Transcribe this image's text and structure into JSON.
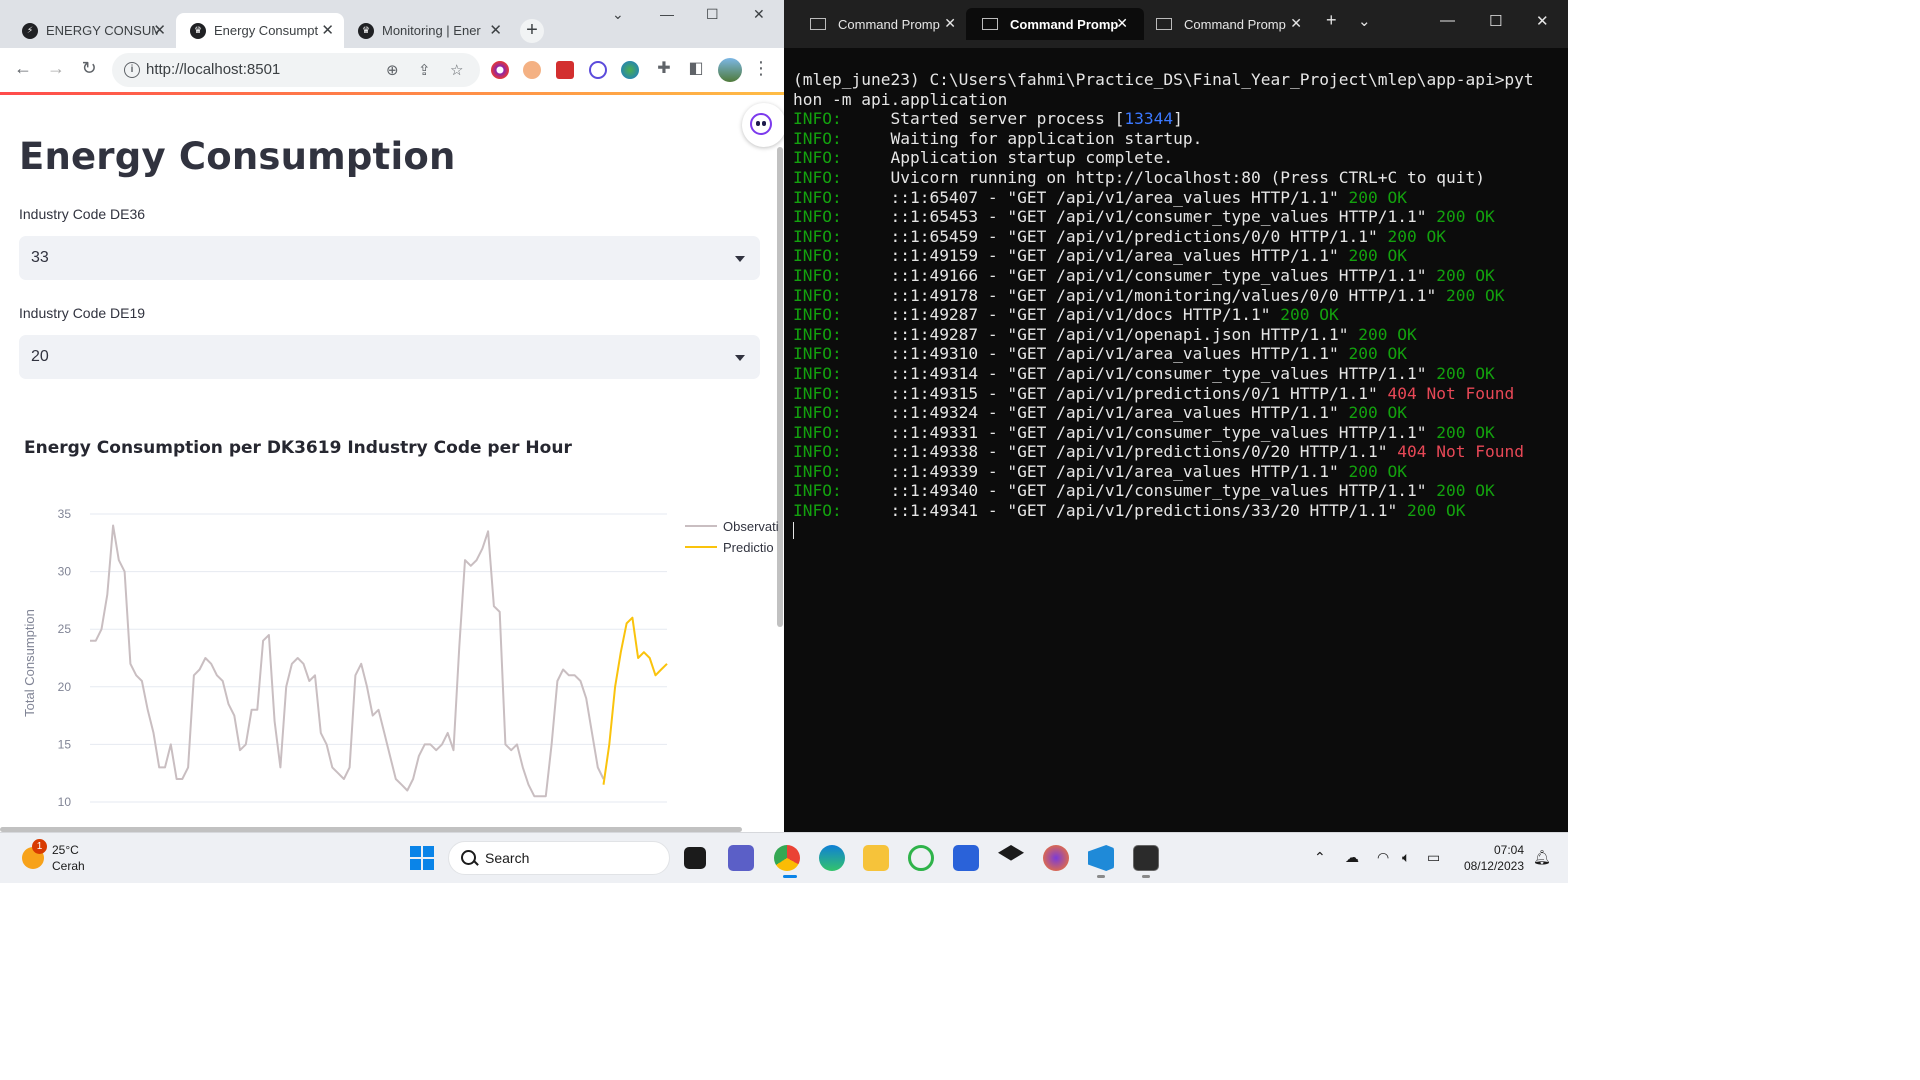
{
  "browser": {
    "tabs": [
      {
        "title": "ENERGY CONSUM",
        "active": false
      },
      {
        "title": "Energy Consumpt",
        "active": true
      },
      {
        "title": "Monitoring | Ener",
        "active": false
      }
    ],
    "url": "http://localhost:8501"
  },
  "app": {
    "title": "Energy Consumption",
    "select1": {
      "label": "Industry Code DE36",
      "value": "33"
    },
    "select2": {
      "label": "Industry Code DE19",
      "value": "20"
    },
    "chart_title": "Energy Consumption per DK3619 Industry Code per Hour"
  },
  "chart_data": {
    "type": "line",
    "ylabel": "Total Consumption",
    "xlabel": "",
    "ylim": [
      10,
      35
    ],
    "yticks": [
      "35",
      "30",
      "25",
      "20",
      "15",
      "10"
    ],
    "legend": {
      "placement": "right",
      "entries": [
        "Observati",
        "Predictio"
      ]
    },
    "series": [
      {
        "name": "Observati",
        "color": "#c9bec1",
        "values": [
          24,
          24,
          25,
          28,
          34,
          31,
          30,
          22,
          21,
          20.5,
          18,
          16,
          13,
          13,
          15,
          12,
          12,
          13,
          21,
          21.5,
          22.5,
          22,
          21,
          20.5,
          18.5,
          17.5,
          14.5,
          15,
          18,
          18,
          24,
          24.5,
          17,
          13,
          20,
          22,
          22.5,
          22,
          20.5,
          21,
          16,
          15,
          13,
          12.5,
          12,
          13,
          21,
          22,
          20,
          17.5,
          18,
          16,
          14,
          12,
          11.5,
          11,
          12,
          14,
          15,
          15,
          14.5,
          15,
          16,
          14.5,
          23.5,
          31,
          30.5,
          31,
          32,
          33.5,
          27,
          26.5,
          15,
          14.5,
          15,
          13,
          11.5,
          10.5,
          10.5,
          10.5,
          15,
          20.5,
          21.5,
          21,
          21,
          20.5,
          19,
          16,
          13,
          12
        ]
      },
      {
        "name": "Predictio",
        "color": "#fac30c",
        "values": [
          11.5,
          15,
          20,
          23,
          25.5,
          26,
          22.5,
          23,
          22.5,
          21,
          21.5,
          22
        ]
      }
    ],
    "grid": true
  },
  "terminal": {
    "tabs": [
      "Command Promp",
      "Command Promp",
      "Command Promp"
    ],
    "prompt": "(mlep_june23) C:\\Users\\fahmi\\Practice_DS\\Final_Year_Project\\mlep\\app-api>pyt",
    "prompt_cont": "hon -m api.application",
    "lines": [
      {
        "level": "INFO:",
        "text": "     Started server process [",
        "pid": "13344",
        "tail": "]"
      },
      {
        "level": "INFO:",
        "text": "     Waiting for application startup."
      },
      {
        "level": "INFO:",
        "text": "     Application startup complete."
      },
      {
        "level": "INFO:",
        "text": "     Uvicorn running on http://localhost:80 (Press CTRL+C to quit)"
      },
      {
        "level": "INFO:",
        "text": "     ::1:65407 - \"GET /api/v1/area_values HTTP/1.1\" ",
        "status": "200 OK",
        "ok": true
      },
      {
        "level": "INFO:",
        "text": "     ::1:65453 - \"GET /api/v1/consumer_type_values HTTP/1.1\" ",
        "status": "200 OK",
        "ok": true
      },
      {
        "level": "INFO:",
        "text": "     ::1:65459 - \"GET /api/v1/predictions/0/0 HTTP/1.1\" ",
        "status": "200 OK",
        "ok": true
      },
      {
        "level": "INFO:",
        "text": "     ::1:49159 - \"GET /api/v1/area_values HTTP/1.1\" ",
        "status": "200 OK",
        "ok": true
      },
      {
        "level": "INFO:",
        "text": "     ::1:49166 - \"GET /api/v1/consumer_type_values HTTP/1.1\" ",
        "status": "200 OK",
        "ok": true
      },
      {
        "level": "INFO:",
        "text": "     ::1:49178 - \"GET /api/v1/monitoring/values/0/0 HTTP/1.1\" ",
        "status": "200 OK",
        "ok": true
      },
      {
        "level": "INFO:",
        "text": "     ::1:49287 - \"GET /api/v1/docs HTTP/1.1\" ",
        "status": "200 OK",
        "ok": true
      },
      {
        "level": "INFO:",
        "text": "     ::1:49287 - \"GET /api/v1/openapi.json HTTP/1.1\" ",
        "status": "200 OK",
        "ok": true
      },
      {
        "level": "INFO:",
        "text": "     ::1:49310 - \"GET /api/v1/area_values HTTP/1.1\" ",
        "status": "200 OK",
        "ok": true
      },
      {
        "level": "INFO:",
        "text": "     ::1:49314 - \"GET /api/v1/consumer_type_values HTTP/1.1\" ",
        "status": "200 OK",
        "ok": true
      },
      {
        "level": "INFO:",
        "text": "     ::1:49315 - \"GET /api/v1/predictions/0/1 HTTP/1.1\" ",
        "status": "404 Not Found",
        "ok": false
      },
      {
        "level": "INFO:",
        "text": "     ::1:49324 - \"GET /api/v1/area_values HTTP/1.1\" ",
        "status": "200 OK",
        "ok": true
      },
      {
        "level": "INFO:",
        "text": "     ::1:49331 - \"GET /api/v1/consumer_type_values HTTP/1.1\" ",
        "status": "200 OK",
        "ok": true
      },
      {
        "level": "INFO:",
        "text": "     ::1:49338 - \"GET /api/v1/predictions/0/20 HTTP/1.1\" ",
        "status": "404 Not Found",
        "ok": false
      },
      {
        "level": "INFO:",
        "text": "     ::1:49339 - \"GET /api/v1/area_values HTTP/1.1\" ",
        "status": "200 OK",
        "ok": true
      },
      {
        "level": "INFO:",
        "text": "     ::1:49340 - \"GET /api/v1/consumer_type_values HTTP/1.1\" ",
        "status": "200 OK",
        "ok": true
      },
      {
        "level": "INFO:",
        "text": "     ::1:49341 - \"GET /api/v1/predictions/33/20 HTTP/1.1\" ",
        "status": "200 OK",
        "ok": true
      }
    ]
  },
  "taskbar": {
    "weather_temp": "25°C",
    "weather_desc": "Cerah",
    "weather_badge": "1",
    "search_placeholder": "Search",
    "time": "07:04",
    "date": "08/12/2023"
  }
}
